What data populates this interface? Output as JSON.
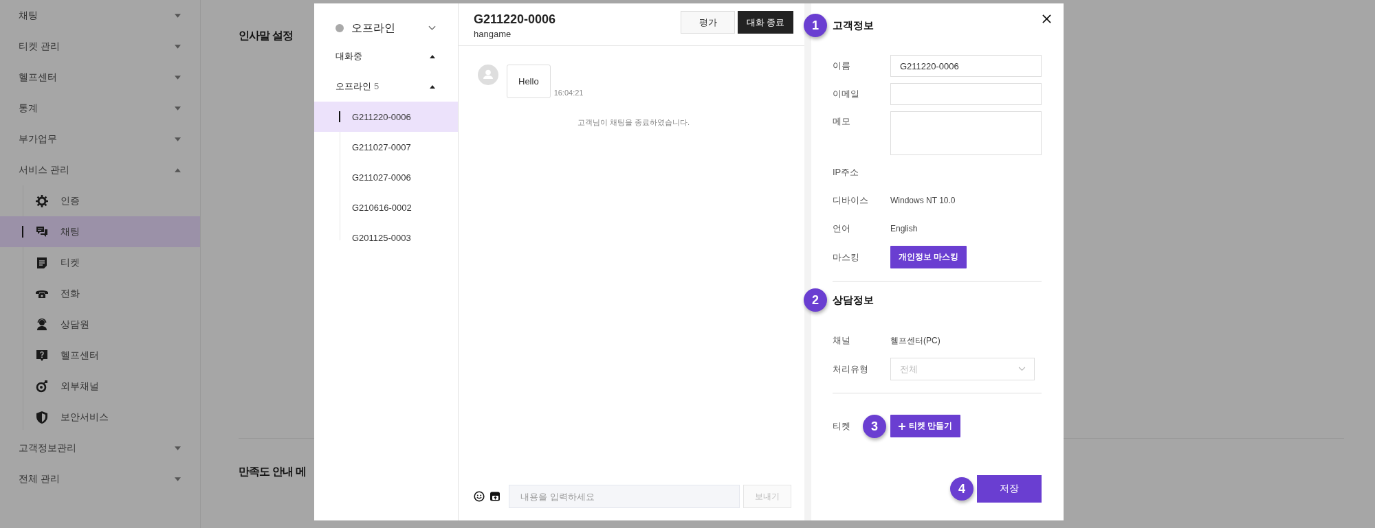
{
  "sidebar": {
    "items": [
      {
        "label": "채팅",
        "expanded": false
      },
      {
        "label": "티켓 관리",
        "expanded": false
      },
      {
        "label": "헬프센터",
        "expanded": false
      },
      {
        "label": "통계",
        "expanded": false
      },
      {
        "label": "부가업무",
        "expanded": false
      },
      {
        "label": "서비스 관리",
        "expanded": true,
        "children": [
          {
            "label": "인증",
            "selected": false
          },
          {
            "label": "채팅",
            "selected": true
          },
          {
            "label": "티켓",
            "selected": false
          },
          {
            "label": "전화",
            "selected": false
          },
          {
            "label": "상담원",
            "selected": false
          },
          {
            "label": "헬프센터",
            "selected": false
          },
          {
            "label": "외부채널",
            "selected": false
          },
          {
            "label": "보안서비스",
            "selected": false
          }
        ]
      },
      {
        "label": "고객정보관리",
        "expanded": false
      },
      {
        "label": "전체 관리",
        "expanded": false
      }
    ]
  },
  "page": {
    "sections": [
      {
        "title": "인사말 설정"
      },
      {
        "title": "만족도 안내 메"
      }
    ]
  },
  "chat_modal": {
    "status": {
      "label": "오프라인"
    },
    "groups": [
      {
        "label": "대화중",
        "expanded": true
      },
      {
        "label": "오프라인",
        "count": "5",
        "expanded": true,
        "items": [
          {
            "label": "G211220-0006",
            "selected": true
          },
          {
            "label": "G211027-0007",
            "selected": false
          },
          {
            "label": "G211027-0006",
            "selected": false
          },
          {
            "label": "G210616-0002",
            "selected": false
          },
          {
            "label": "G201125-0003",
            "selected": false
          }
        ]
      }
    ],
    "conversation": {
      "title": "G211220-0006",
      "subtitle": "hangame",
      "buttons": [
        {
          "label": "평가",
          "kind": "secondary"
        },
        {
          "label": "대화 종료",
          "kind": "primary"
        }
      ],
      "messages": [
        {
          "kind": "customer",
          "text": "Hello",
          "time": "16:04:21"
        },
        {
          "kind": "system",
          "text": "고객님이 채팅을 종료하였습니다."
        }
      ],
      "composer": {
        "placeholder": "내용을 입력하세요",
        "send": "보내기",
        "send_disabled": true
      }
    },
    "customer_panel": {
      "sections": [
        {
          "marker": "1",
          "title": "고객정보",
          "fields": [
            {
              "kind": "input",
              "label": "이름",
              "value": "G211220-0006"
            },
            {
              "kind": "input",
              "label": "이메일"
            },
            {
              "kind": "textarea",
              "label": "메모"
            },
            {
              "kind": "text",
              "label": "IP주소"
            },
            {
              "kind": "text",
              "label": "디바이스",
              "value": "Windows NT 10.0"
            },
            {
              "kind": "text",
              "label": "언어",
              "value": "English"
            },
            {
              "kind": "button",
              "label": "마스킹",
              "button": "개인정보 마스킹"
            }
          ]
        },
        {
          "marker": "2",
          "title": "상담정보",
          "fields": [
            {
              "kind": "text",
              "label": "채널",
              "value": "헬프센터(PC)"
            },
            {
              "kind": "select",
              "label": "처리유형",
              "placeholder": "전체"
            }
          ]
        },
        {
          "fields": [
            {
              "kind": "create",
              "label": "티켓",
              "button": "티켓 만들기",
              "marker": "3"
            }
          ]
        }
      ],
      "save": {
        "label": "저장",
        "marker": "4"
      }
    }
  }
}
